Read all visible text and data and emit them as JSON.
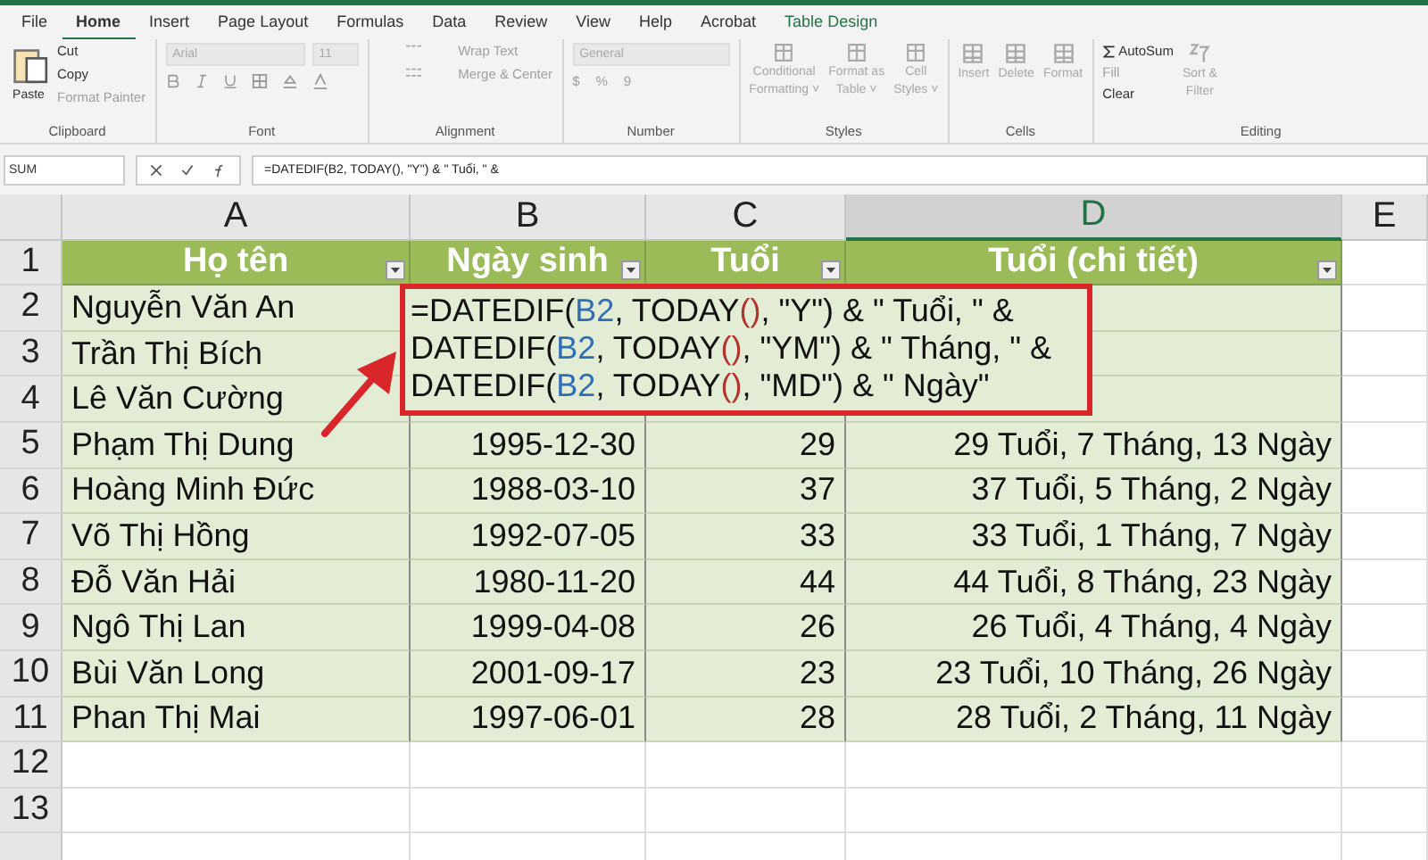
{
  "ribbon": {
    "tabs": [
      {
        "label": "File",
        "selected": false,
        "kind": "normal"
      },
      {
        "label": "Home",
        "selected": true,
        "kind": "normal"
      },
      {
        "label": "Insert",
        "selected": false,
        "kind": "normal"
      },
      {
        "label": "Page Layout",
        "selected": false,
        "kind": "normal"
      },
      {
        "label": "Formulas",
        "selected": false,
        "kind": "normal"
      },
      {
        "label": "Data",
        "selected": false,
        "kind": "normal"
      },
      {
        "label": "Review",
        "selected": false,
        "kind": "normal"
      },
      {
        "label": "View",
        "selected": false,
        "kind": "normal"
      },
      {
        "label": "Help",
        "selected": false,
        "kind": "normal"
      },
      {
        "label": "Acrobat",
        "selected": false,
        "kind": "normal"
      },
      {
        "label": "Table Design",
        "selected": false,
        "kind": "contextual"
      }
    ],
    "clipboard": {
      "label": "Clipboard",
      "paste": "Paste",
      "cut": "Cut",
      "copy": "Copy",
      "format_painter": "Format Painter"
    },
    "font": {
      "label": "Font",
      "font_name": "Arial",
      "font_size": "11"
    },
    "alignment": {
      "label": "Alignment",
      "wrap_text": "Wrap Text",
      "merge_center": "Merge & Center"
    },
    "number": {
      "label": "Number",
      "format": "General",
      "currency": "$",
      "percent": "%",
      "comma": "9"
    },
    "styles": {
      "label": "Styles",
      "buttons": [
        {
          "line1": "Conditional",
          "line2": "Formatting ˅"
        },
        {
          "line1": "Format as",
          "line2": "Table ˅"
        },
        {
          "line1": "Cell",
          "line2": "Styles ˅"
        }
      ]
    },
    "cells": {
      "label": "Cells",
      "buttons": [
        "Insert",
        "Delete",
        "Format"
      ]
    },
    "editing": {
      "label": "Editing",
      "autosum": "AutoSum",
      "fill": "Fill",
      "clear": "Clear",
      "sort_line1": "Sort &",
      "sort_line2": "Filter"
    }
  },
  "formula_bar": {
    "name_box": "SUM",
    "formula": "=DATEDIF(B2, TODAY(), \"Y\") & \" Tuổi, \" &"
  },
  "sheet": {
    "columns": [
      {
        "letter": "A",
        "selected": false
      },
      {
        "letter": "B",
        "selected": false
      },
      {
        "letter": "C",
        "selected": false
      },
      {
        "letter": "D",
        "selected": true
      },
      {
        "letter": "E",
        "selected": false
      }
    ],
    "header_row": "1",
    "headers": [
      "Họ tên",
      "Ngày sinh",
      "Tuổi",
      "Tuổi (chi tiết)"
    ],
    "rows": [
      {
        "num": "2",
        "name": "Nguyễn Văn An"
      },
      {
        "num": "3",
        "name": "Trần Thị Bích"
      },
      {
        "num": "4",
        "name": "Lê Văn Cường"
      },
      {
        "num": "5",
        "name": "Phạm Thị Dung",
        "birth": "1995-12-30",
        "age": "29",
        "detail": "29 Tuổi, 7 Tháng, 13 Ngày"
      },
      {
        "num": "6",
        "name": "Hoàng Minh Đức",
        "birth": "1988-03-10",
        "age": "37",
        "detail": "37 Tuổi, 5 Tháng, 2 Ngày"
      },
      {
        "num": "7",
        "name": "Võ Thị Hồng",
        "birth": "1992-07-05",
        "age": "33",
        "detail": "33 Tuổi, 1 Tháng, 7 Ngày"
      },
      {
        "num": "8",
        "name": "Đỗ Văn Hải",
        "birth": "1980-11-20",
        "age": "44",
        "detail": "44 Tuổi, 8 Tháng, 23 Ngày"
      },
      {
        "num": "9",
        "name": "Ngô Thị Lan",
        "birth": "1999-04-08",
        "age": "26",
        "detail": "26 Tuổi, 4 Tháng, 4 Ngày"
      },
      {
        "num": "10",
        "name": "Bùi Văn Long",
        "birth": "2001-09-17",
        "age": "23",
        "detail": "23 Tuổi, 10 Tháng, 26 Ngày"
      },
      {
        "num": "11",
        "name": "Phan Thị Mai",
        "birth": "1997-06-01",
        "age": "28",
        "detail": "28 Tuổi, 2 Tháng, 11 Ngày"
      }
    ],
    "empty_rows": [
      "12",
      "13"
    ],
    "editor": {
      "lines": [
        [
          {
            "text": "=DATEDIF(",
            "kind": "plain"
          },
          {
            "text": "B2",
            "kind": "ref"
          },
          {
            "text": ", TODAY",
            "kind": "plain"
          },
          {
            "text": "()",
            "kind": "paren"
          },
          {
            "text": ", \"Y\") & \" Tuổi, \" &",
            "kind": "plain"
          }
        ],
        [
          {
            "text": " DATEDIF(",
            "kind": "plain"
          },
          {
            "text": "B2",
            "kind": "ref"
          },
          {
            "text": ", TODAY",
            "kind": "plain"
          },
          {
            "text": "()",
            "kind": "paren"
          },
          {
            "text": ", \"YM\") & \" Tháng, \" &",
            "kind": "plain"
          }
        ],
        [
          {
            "text": " DATEDIF(",
            "kind": "plain"
          },
          {
            "text": "B2",
            "kind": "ref"
          },
          {
            "text": ", TODAY",
            "kind": "plain"
          },
          {
            "text": "()",
            "kind": "paren"
          },
          {
            "text": ", \"MD\") & \" Ngày\"",
            "kind": "plain"
          }
        ]
      ]
    }
  }
}
